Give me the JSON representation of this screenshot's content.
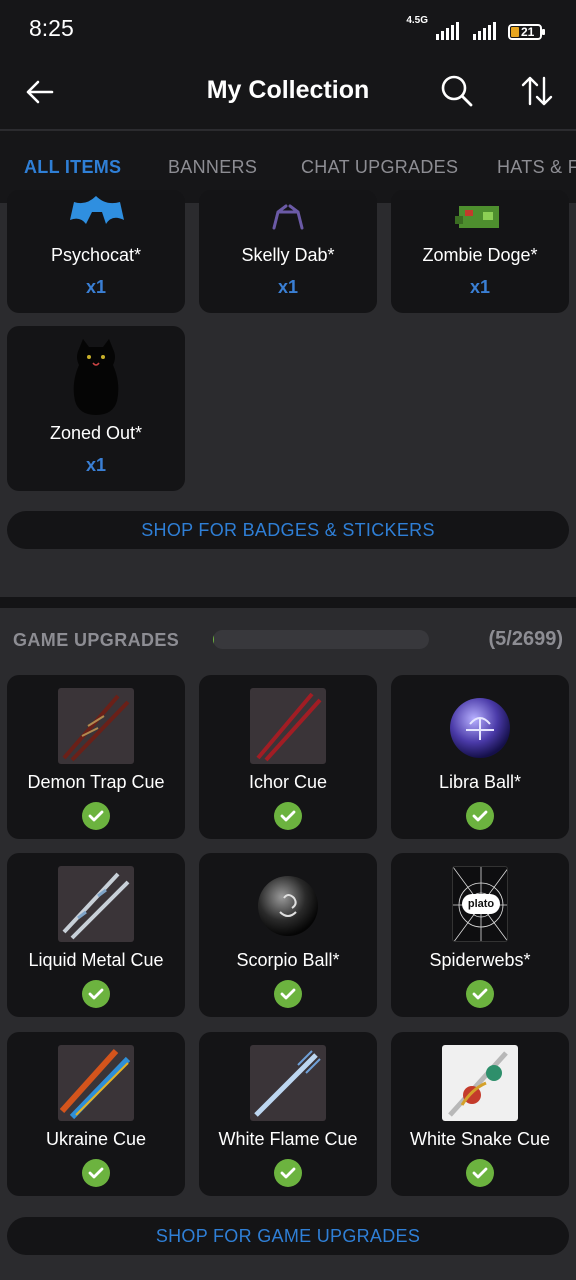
{
  "status_bar": {
    "time": "8:25",
    "network": "4.5G",
    "battery": "21"
  },
  "app_bar": {
    "title": "My Collection"
  },
  "tabs": [
    {
      "label": "ALL ITEMS",
      "active": true
    },
    {
      "label": "BANNERS",
      "active": false
    },
    {
      "label": "CHAT UPGRADES",
      "active": false
    },
    {
      "label": "HATS & F",
      "active": false
    }
  ],
  "badges": {
    "items": [
      {
        "name": "Psychocat*",
        "qty": "x1"
      },
      {
        "name": "Skelly Dab*",
        "qty": "x1"
      },
      {
        "name": "Zombie Doge*",
        "qty": "x1"
      },
      {
        "name": "Zoned Out*",
        "qty": "x1"
      }
    ],
    "shop_label": "SHOP FOR BADGES & STICKERS"
  },
  "game_upgrades": {
    "title": "GAME UPGRADES",
    "count": "(5/2699)",
    "progress_fraction": 0.0019,
    "items": [
      {
        "name": "Demon Trap Cue",
        "owned": true
      },
      {
        "name": "Ichor Cue",
        "owned": true
      },
      {
        "name": "Libra Ball*",
        "owned": true
      },
      {
        "name": "Liquid Metal Cue",
        "owned": true
      },
      {
        "name": "Scorpio Ball*",
        "owned": true
      },
      {
        "name": "Spiderwebs*",
        "owned": true
      },
      {
        "name": "Ukraine Cue",
        "owned": true
      },
      {
        "name": "White Flame Cue",
        "owned": true
      },
      {
        "name": "White Snake Cue",
        "owned": true
      }
    ],
    "spiderwebs_logo": "plato",
    "shop_label": "SHOP FOR GAME UPGRADES"
  },
  "colors": {
    "accent": "#2f7fd6",
    "check": "#6cb33f",
    "card": "#141416",
    "background": "#2b2b2e"
  }
}
